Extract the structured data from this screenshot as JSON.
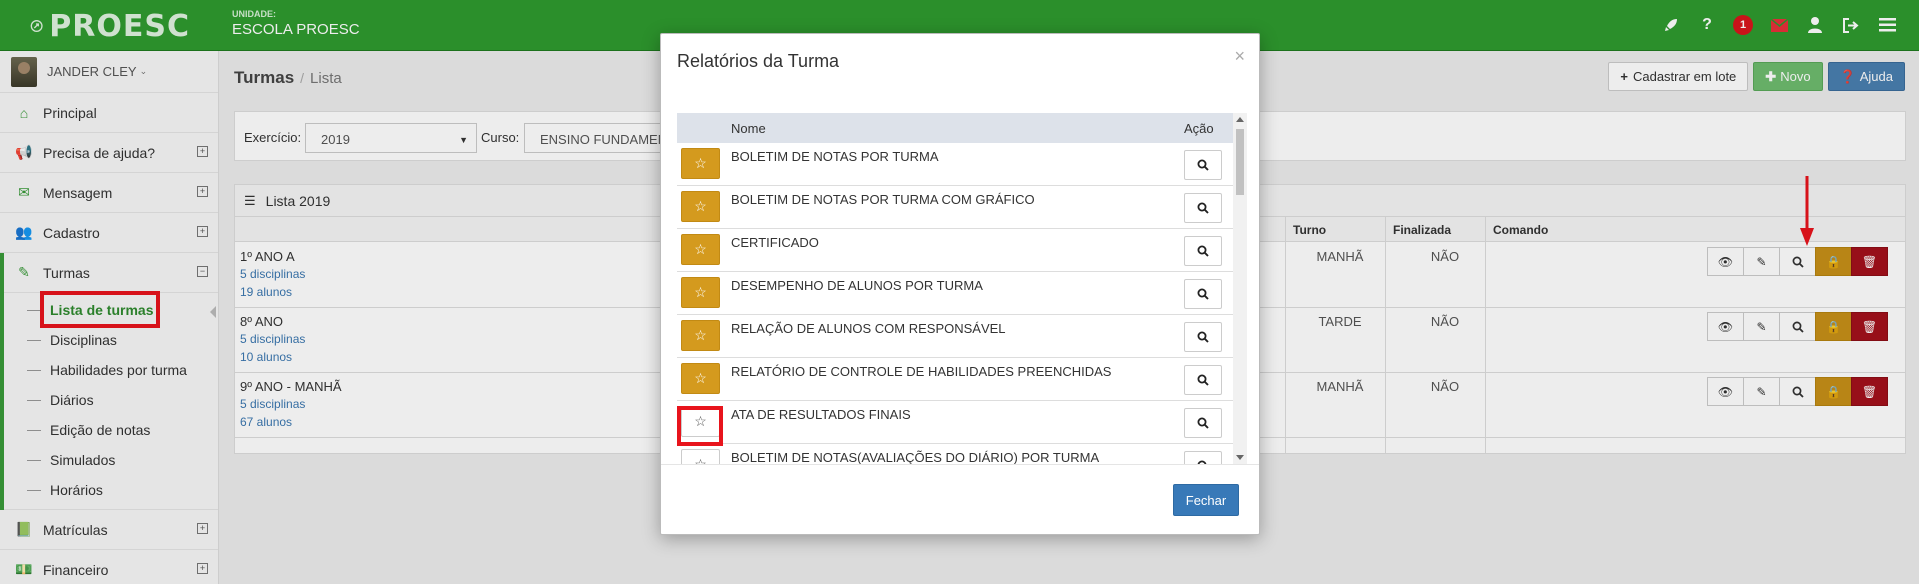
{
  "header": {
    "brand": "PROESC",
    "unit_label": "UNIDADE:",
    "unit_name": "ESCOLA PROESC",
    "notification_count": "1",
    "icons": [
      "rocket-icon",
      "help-icon",
      "notification-badge",
      "mail-icon",
      "user-icon",
      "logout-icon",
      "menu-icon"
    ]
  },
  "sidebar": {
    "user_name": "JANDER CLEY",
    "items": [
      {
        "label": "Principal",
        "icon": "home-icon"
      },
      {
        "label": "Precisa de ajuda?",
        "icon": "megaphone-icon"
      },
      {
        "label": "Mensagem",
        "icon": "envelope-icon"
      },
      {
        "label": "Cadastro",
        "icon": "users-icon"
      },
      {
        "label": "Turmas",
        "icon": "pencil-icon"
      },
      {
        "label": "Matrículas",
        "icon": "book-icon"
      },
      {
        "label": "Financeiro",
        "icon": "money-icon"
      }
    ],
    "turmas_sub": [
      "Lista de turmas",
      "Disciplinas",
      "Habilidades por turma",
      "Diários",
      "Edição de notas",
      "Simulados",
      "Horários"
    ]
  },
  "page": {
    "title": "Turmas",
    "subtitle": "Lista",
    "buttons": {
      "batch": "Cadastrar em lote",
      "new": "Novo",
      "help": "Ajuda"
    }
  },
  "filters": {
    "exercicio_label": "Exercício:",
    "exercicio_value": "2019",
    "curso_label": "Curso:",
    "curso_value": "ENSINO FUNDAMEN"
  },
  "list": {
    "title": "Lista 2019",
    "columns": {
      "turno": "Turno",
      "finalizada": "Finalizada",
      "comando": "Comando"
    },
    "rows": [
      {
        "name": "1º ANO A",
        "disciplinas": "5 disciplinas",
        "alunos": "19 alunos",
        "turno": "MANHÃ",
        "finalizada": "NÃO"
      },
      {
        "name": "8º ANO",
        "disciplinas": "5 disciplinas",
        "alunos": "10 alunos",
        "turno": "TARDE",
        "finalizada": "NÃO"
      },
      {
        "name": "9º ANO - MANHÃ",
        "disciplinas": "5 disciplinas",
        "alunos": "67 alunos",
        "turno": "MANHÃ",
        "finalizada": "NÃO"
      }
    ]
  },
  "modal": {
    "title": "Relatórios da Turma",
    "close_symbol": "×",
    "col_name": "Nome",
    "col_action": "Ação",
    "reports": [
      {
        "name": "BOLETIM DE NOTAS POR TURMA",
        "favorite": true
      },
      {
        "name": "BOLETIM DE NOTAS POR TURMA COM GRÁFICO",
        "favorite": true
      },
      {
        "name": "CERTIFICADO",
        "favorite": true
      },
      {
        "name": "DESEMPENHO DE ALUNOS POR TURMA",
        "favorite": true
      },
      {
        "name": "RELAÇÃO DE ALUNOS COM RESPONSÁVEL",
        "favorite": true
      },
      {
        "name": "RELATÓRIO DE CONTROLE DE HABILIDADES PREENCHIDAS",
        "favorite": true
      },
      {
        "name": "ATA DE RESULTADOS FINAIS",
        "favorite": false
      },
      {
        "name": "BOLETIM DE NOTAS(AVALIAÇÕES DO DIÁRIO) POR TURMA",
        "favorite": false
      }
    ],
    "close_button": "Fechar"
  },
  "colors": {
    "header_green": "#2f9a2f",
    "favorite_gold": "#d49a1e",
    "danger_red": "#a3111b",
    "primary_blue": "#3879b8",
    "annotation_red": "#e8141c"
  }
}
